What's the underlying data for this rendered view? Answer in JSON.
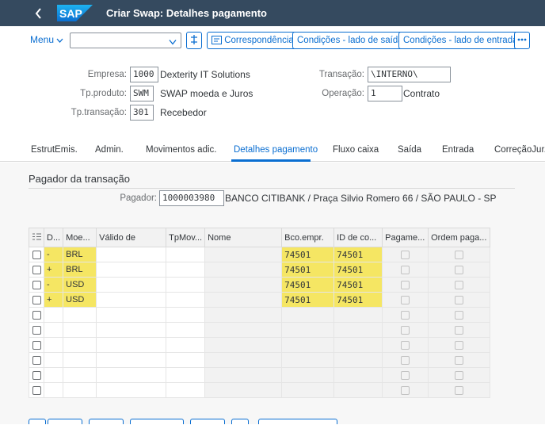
{
  "shell": {
    "title": "Criar Swap: Detalhes pagamento",
    "logo_text": "SAP",
    "back_icon": "chevron-left-icon"
  },
  "toolbar": {
    "menu_label": "Menu",
    "command_field_value": "",
    "buttons": {
      "correspondencia": "Correspondência",
      "cond_saida": "Condições - lado de saída",
      "cond_entrada": "Condições - lado de entrada"
    }
  },
  "header": {
    "empresa_label": "Empresa:",
    "empresa_value": "1000",
    "empresa_desc": "Dexterity IT Solutions",
    "tpproduto_label": "Tp.produto:",
    "tpproduto_value": "SWM",
    "tpproduto_desc": "SWAP moeda e Juros",
    "tptransacao_label": "Tp.transação:",
    "tptransacao_value": "301",
    "tptransacao_desc": "Recebedor",
    "transacao_label": "Transação:",
    "transacao_value": "\\INTERNO\\",
    "operacao_label": "Operação:",
    "operacao_value": "1",
    "operacao_desc": "Contrato"
  },
  "tabs": [
    {
      "label": "EstrutEmis."
    },
    {
      "label": "Admin."
    },
    {
      "label": "Movimentos adic."
    },
    {
      "label": "Detalhes pagamento"
    },
    {
      "label": "Fluxo caixa"
    },
    {
      "label": "Saída"
    },
    {
      "label": "Entrada"
    },
    {
      "label": "CorreçãoJur."
    }
  ],
  "section": {
    "title": "Pagador da transação",
    "pagador_label": "Pagador:",
    "pagador_value": "1000003980",
    "pagador_desc": "BANCO CITIBANK / Praça Silvio Romero 66 / SÃO PAULO - SP"
  },
  "table": {
    "columns": [
      "D...",
      "Moe...",
      "Válido de",
      "TpMov...",
      "Nome",
      "Bco.empr.",
      "ID de co...",
      "Pagame...",
      "Ordem paga..."
    ],
    "rows": [
      {
        "d": "-",
        "moeda": "BRL",
        "valido": "",
        "tpmov": "",
        "nome": "",
        "bco": "74501",
        "id": "74501"
      },
      {
        "d": "+",
        "moeda": "BRL",
        "valido": "",
        "tpmov": "",
        "nome": "",
        "bco": "74501",
        "id": "74501"
      },
      {
        "d": "-",
        "moeda": "USD",
        "valido": "",
        "tpmov": "",
        "nome": "",
        "bco": "74501",
        "id": "74501"
      },
      {
        "d": "+",
        "moeda": "USD",
        "valido": "",
        "tpmov": "",
        "nome": "",
        "bco": "74501",
        "id": "74501"
      },
      {
        "d": "",
        "moeda": "",
        "valido": "",
        "tpmov": "",
        "nome": "",
        "bco": "",
        "id": ""
      },
      {
        "d": "",
        "moeda": "",
        "valido": "",
        "tpmov": "",
        "nome": "",
        "bco": "",
        "id": ""
      },
      {
        "d": "",
        "moeda": "",
        "valido": "",
        "tpmov": "",
        "nome": "",
        "bco": "",
        "id": ""
      },
      {
        "d": "",
        "moeda": "",
        "valido": "",
        "tpmov": "",
        "nome": "",
        "bco": "",
        "id": ""
      },
      {
        "d": "",
        "moeda": "",
        "valido": "",
        "tpmov": "",
        "nome": "",
        "bco": "",
        "id": ""
      },
      {
        "d": "",
        "moeda": "",
        "valido": "",
        "tpmov": "",
        "nome": "",
        "bco": "",
        "id": ""
      }
    ]
  },
  "colors": {
    "shell_bg": "#354a5f",
    "accent": "#0a6ed1",
    "highlight": "#f5e663"
  }
}
